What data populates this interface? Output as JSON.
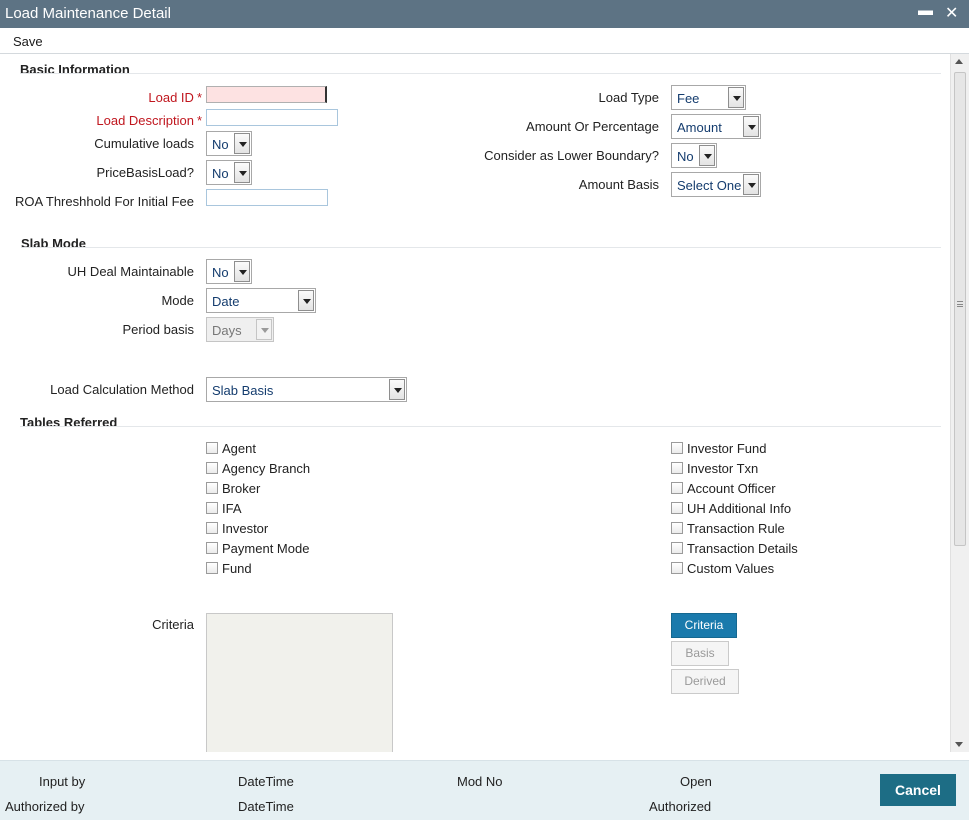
{
  "window": {
    "title": "Load Maintenance Detail",
    "minimize": "▬",
    "close": "✕"
  },
  "toolbar": {
    "save_label": "Save"
  },
  "basic": {
    "heading": "Basic Information",
    "load_id_label": "Load ID",
    "load_desc_label": "Load Description",
    "required_mark": "*",
    "cumulative_label": "Cumulative loads",
    "cumulative_value": "No",
    "price_basis_label": "PriceBasisLoad?",
    "price_basis_value": "No",
    "roa_label": "ROA Threshhold For Initial Fee",
    "load_type_label": "Load Type",
    "load_type_value": "Fee",
    "amount_pct_label": "Amount Or Percentage",
    "amount_pct_value": "Amount",
    "lower_boundary_label": "Consider as Lower Boundary?",
    "lower_boundary_value": "No",
    "amount_basis_label": "Amount Basis",
    "amount_basis_value": "Select One"
  },
  "slab": {
    "heading": "Slab Mode",
    "uh_deal_label": "UH Deal Maintainable",
    "uh_deal_value": "No",
    "mode_label": "Mode",
    "mode_value": "Date",
    "period_label": "Period basis",
    "period_value": "Days",
    "calc_label": "Load Calculation Method",
    "calc_value": "Slab Basis"
  },
  "tables": {
    "heading": "Tables Referred",
    "left": [
      "Agent",
      "Agency Branch",
      "Broker",
      "IFA",
      "Investor",
      "Payment Mode",
      "Fund"
    ],
    "right": [
      "Investor Fund",
      "Investor Txn",
      "Account Officer",
      "UH Additional Info",
      "Transaction Rule",
      "Transaction Details",
      "Custom Values"
    ]
  },
  "criteria": {
    "label": "Criteria",
    "btn_criteria": "Criteria",
    "btn_basis": "Basis",
    "btn_derived": "Derived"
  },
  "footer": {
    "input_by": "Input by",
    "datetime_1": "DateTime",
    "mod_no": "Mod No",
    "open": "Open",
    "authorized_by": "Authorized by",
    "datetime_2": "DateTime",
    "authorized": "Authorized",
    "cancel": "Cancel"
  },
  "colors": {
    "titlebar": "#5d7384",
    "primary_button": "#1a7aac",
    "cancel_button": "#1d6d85",
    "required": "#c0161e",
    "footer_bg": "#e6f0f3"
  }
}
